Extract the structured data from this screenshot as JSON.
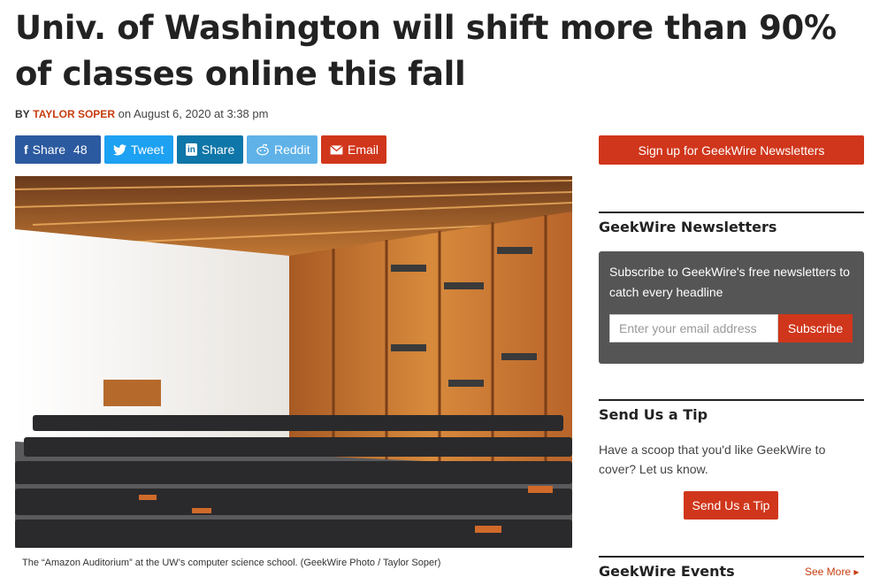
{
  "article": {
    "headline": "Univ. of Washington will shift more than 90% of classes online this fall",
    "byline_prefix": "BY",
    "author": "TAYLOR SOPER",
    "date_text": "on August 6, 2020 at 3:38 pm",
    "caption": "The “Amazon Auditorium” at the UW’s computer science school. (GeekWire Photo / Taylor Soper)"
  },
  "share": {
    "facebook": {
      "icon": "f",
      "label": "Share",
      "count": "48"
    },
    "twitter": {
      "label": "Tweet"
    },
    "linkedin": {
      "icon": "in",
      "label": "Share"
    },
    "reddit": {
      "label": "Reddit"
    },
    "email": {
      "label": "Email"
    }
  },
  "sidebar": {
    "signup_label": "Sign up for GeekWire Newsletters",
    "newsletters": {
      "heading": "GeekWire Newsletters",
      "text": "Subscribe to GeekWire's free newsletters to catch every headline",
      "placeholder": "Enter your email address",
      "button": "Subscribe"
    },
    "tip": {
      "heading": "Send Us a Tip",
      "text": "Have a scoop that you'd like GeekWire to cover? Let us know.",
      "button": "Send Us a Tip"
    },
    "events": {
      "heading": "GeekWire Events",
      "see_more": "See More ▸"
    }
  },
  "colors": {
    "accent": "#d0361b",
    "facebook": "#2c5aa0",
    "twitter": "#1da1f2",
    "linkedin": "#0e76a8",
    "reddit": "#5fb2e8"
  }
}
